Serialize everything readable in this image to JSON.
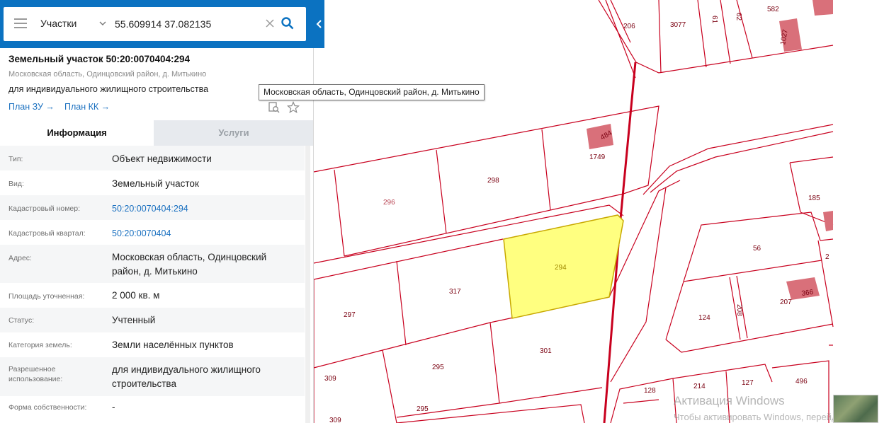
{
  "search": {
    "layer": "Участки",
    "value": "55.609914 37.082135"
  },
  "object": {
    "title": "Земельный участок 50:20:0070404:294",
    "address": "Московская область, Одинцовский район, д. Митькино",
    "use": "для индивидуального жилищного строительства",
    "plan_zu": "План ЗУ →",
    "plan_kk": "План КК →"
  },
  "tabs": [
    "Информация",
    "Услуги"
  ],
  "properties": [
    {
      "label": "Тип:",
      "value": "Объект недвижимости"
    },
    {
      "label": "Вид:",
      "value": "Земельный участок"
    },
    {
      "label": "Кадастровый номер:",
      "value": "50:20:0070404:294"
    },
    {
      "label": "Кадастровый квартал:",
      "value": "50:20:0070404"
    },
    {
      "label": "Адрес:",
      "value": "Московская область, Одинцовский район, д. Митькино"
    },
    {
      "label": "Площадь уточненная:",
      "value": "2 000 кв. м"
    },
    {
      "label": "Статус:",
      "value": "Учтенный"
    },
    {
      "label": "Категория земель:",
      "value": "Земли населённых пунктов"
    },
    {
      "label": "Разрешенное использование:",
      "value": "для индивидуального жилищного строительства"
    },
    {
      "label": "Форма собственности:",
      "value": "-"
    }
  ],
  "tooltip": "Московская область, Одинцовский район, д. Митькино",
  "map_labels": {
    "p206": "206",
    "p3077": "3077",
    "p61": "61",
    "p62": "62",
    "p582": "582",
    "p1027": "1027",
    "p1749": "1749",
    "p484": "484",
    "p296": "296",
    "p298": "298",
    "p185": "185",
    "p56": "56",
    "p2": "2",
    "p294": "294",
    "p317": "317",
    "p297": "297",
    "p366": "366",
    "p207": "207",
    "p124": "124",
    "p208": "208",
    "p301": "301",
    "p295a": "295",
    "p309a": "309",
    "p128": "128",
    "p214": "214",
    "p127": "127",
    "p496": "496",
    "p295b": "295",
    "p309b": "309"
  },
  "watermark": {
    "line1": "Активация Windows",
    "line2": "Чтобы активировать Windows, перейдите в"
  },
  "colors": {
    "header": "#0b72c1",
    "selected_parcel": "#ffff80",
    "parcel_border": "#c8001e",
    "building": "#d9707a",
    "link": "#1a70c0"
  }
}
